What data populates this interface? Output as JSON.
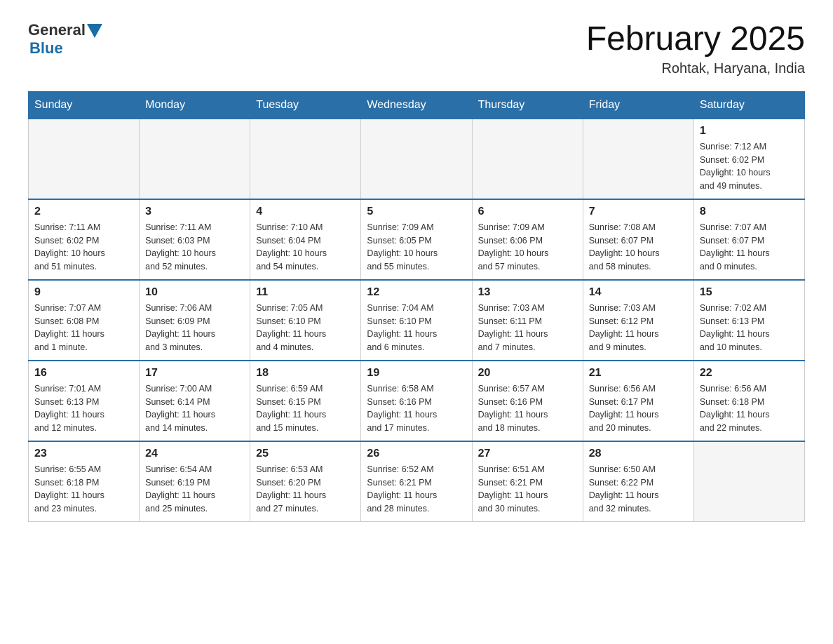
{
  "header": {
    "logo_general": "General",
    "logo_blue": "Blue",
    "month_title": "February 2025",
    "location": "Rohtak, Haryana, India"
  },
  "weekdays": [
    "Sunday",
    "Monday",
    "Tuesday",
    "Wednesday",
    "Thursday",
    "Friday",
    "Saturday"
  ],
  "weeks": [
    [
      {
        "day": "",
        "info": ""
      },
      {
        "day": "",
        "info": ""
      },
      {
        "day": "",
        "info": ""
      },
      {
        "day": "",
        "info": ""
      },
      {
        "day": "",
        "info": ""
      },
      {
        "day": "",
        "info": ""
      },
      {
        "day": "1",
        "info": "Sunrise: 7:12 AM\nSunset: 6:02 PM\nDaylight: 10 hours\nand 49 minutes."
      }
    ],
    [
      {
        "day": "2",
        "info": "Sunrise: 7:11 AM\nSunset: 6:02 PM\nDaylight: 10 hours\nand 51 minutes."
      },
      {
        "day": "3",
        "info": "Sunrise: 7:11 AM\nSunset: 6:03 PM\nDaylight: 10 hours\nand 52 minutes."
      },
      {
        "day": "4",
        "info": "Sunrise: 7:10 AM\nSunset: 6:04 PM\nDaylight: 10 hours\nand 54 minutes."
      },
      {
        "day": "5",
        "info": "Sunrise: 7:09 AM\nSunset: 6:05 PM\nDaylight: 10 hours\nand 55 minutes."
      },
      {
        "day": "6",
        "info": "Sunrise: 7:09 AM\nSunset: 6:06 PM\nDaylight: 10 hours\nand 57 minutes."
      },
      {
        "day": "7",
        "info": "Sunrise: 7:08 AM\nSunset: 6:07 PM\nDaylight: 10 hours\nand 58 minutes."
      },
      {
        "day": "8",
        "info": "Sunrise: 7:07 AM\nSunset: 6:07 PM\nDaylight: 11 hours\nand 0 minutes."
      }
    ],
    [
      {
        "day": "9",
        "info": "Sunrise: 7:07 AM\nSunset: 6:08 PM\nDaylight: 11 hours\nand 1 minute."
      },
      {
        "day": "10",
        "info": "Sunrise: 7:06 AM\nSunset: 6:09 PM\nDaylight: 11 hours\nand 3 minutes."
      },
      {
        "day": "11",
        "info": "Sunrise: 7:05 AM\nSunset: 6:10 PM\nDaylight: 11 hours\nand 4 minutes."
      },
      {
        "day": "12",
        "info": "Sunrise: 7:04 AM\nSunset: 6:10 PM\nDaylight: 11 hours\nand 6 minutes."
      },
      {
        "day": "13",
        "info": "Sunrise: 7:03 AM\nSunset: 6:11 PM\nDaylight: 11 hours\nand 7 minutes."
      },
      {
        "day": "14",
        "info": "Sunrise: 7:03 AM\nSunset: 6:12 PM\nDaylight: 11 hours\nand 9 minutes."
      },
      {
        "day": "15",
        "info": "Sunrise: 7:02 AM\nSunset: 6:13 PM\nDaylight: 11 hours\nand 10 minutes."
      }
    ],
    [
      {
        "day": "16",
        "info": "Sunrise: 7:01 AM\nSunset: 6:13 PM\nDaylight: 11 hours\nand 12 minutes."
      },
      {
        "day": "17",
        "info": "Sunrise: 7:00 AM\nSunset: 6:14 PM\nDaylight: 11 hours\nand 14 minutes."
      },
      {
        "day": "18",
        "info": "Sunrise: 6:59 AM\nSunset: 6:15 PM\nDaylight: 11 hours\nand 15 minutes."
      },
      {
        "day": "19",
        "info": "Sunrise: 6:58 AM\nSunset: 6:16 PM\nDaylight: 11 hours\nand 17 minutes."
      },
      {
        "day": "20",
        "info": "Sunrise: 6:57 AM\nSunset: 6:16 PM\nDaylight: 11 hours\nand 18 minutes."
      },
      {
        "day": "21",
        "info": "Sunrise: 6:56 AM\nSunset: 6:17 PM\nDaylight: 11 hours\nand 20 minutes."
      },
      {
        "day": "22",
        "info": "Sunrise: 6:56 AM\nSunset: 6:18 PM\nDaylight: 11 hours\nand 22 minutes."
      }
    ],
    [
      {
        "day": "23",
        "info": "Sunrise: 6:55 AM\nSunset: 6:18 PM\nDaylight: 11 hours\nand 23 minutes."
      },
      {
        "day": "24",
        "info": "Sunrise: 6:54 AM\nSunset: 6:19 PM\nDaylight: 11 hours\nand 25 minutes."
      },
      {
        "day": "25",
        "info": "Sunrise: 6:53 AM\nSunset: 6:20 PM\nDaylight: 11 hours\nand 27 minutes."
      },
      {
        "day": "26",
        "info": "Sunrise: 6:52 AM\nSunset: 6:21 PM\nDaylight: 11 hours\nand 28 minutes."
      },
      {
        "day": "27",
        "info": "Sunrise: 6:51 AM\nSunset: 6:21 PM\nDaylight: 11 hours\nand 30 minutes."
      },
      {
        "day": "28",
        "info": "Sunrise: 6:50 AM\nSunset: 6:22 PM\nDaylight: 11 hours\nand 32 minutes."
      },
      {
        "day": "",
        "info": ""
      }
    ]
  ]
}
